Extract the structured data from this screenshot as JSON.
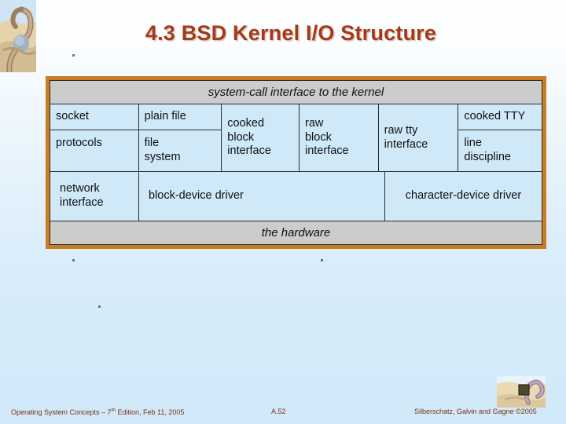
{
  "slide": {
    "title": "4.3 BSD Kernel I/O Structure",
    "title_color": "#a63a16",
    "background_top_color": "#fdfeff",
    "background_bottom_color": "#d2e9fa"
  },
  "figure": {
    "border_color": "#c87d22",
    "band_color": "#cccccc",
    "cell_color": "#cfe9f8",
    "top_band": "system-call interface to the kernel",
    "bottom_band": "the hardware",
    "columns": [
      {
        "name": "network",
        "top": "socket",
        "bottom": "protocols"
      },
      {
        "name": "file",
        "top": "plain file",
        "bottom": "file\nsystem"
      },
      {
        "name": "cooked-block",
        "full": "cooked\nblock\ninterface"
      },
      {
        "name": "raw-block",
        "full": "raw\nblock\ninterface"
      },
      {
        "name": "raw-tty",
        "full": "raw tty\ninterface"
      },
      {
        "name": "cooked-tty",
        "top": "cooked TTY",
        "bottom": "line\ndiscipline"
      }
    ],
    "drivers": [
      {
        "name": "network-interface",
        "label": "network\ninterface"
      },
      {
        "name": "block-device-driver",
        "label": "block-device driver"
      },
      {
        "name": "character-device-driver",
        "label": "character-device driver"
      }
    ]
  },
  "footer": {
    "left_prefix": "Operating System Concepts – 7",
    "left_superscript": "th",
    "left_suffix": " Edition, Feb 11, 2005",
    "page": "A.52",
    "right": "Silberschatz, Galvin and Gagne ©2005",
    "color": "#7a2f10"
  }
}
